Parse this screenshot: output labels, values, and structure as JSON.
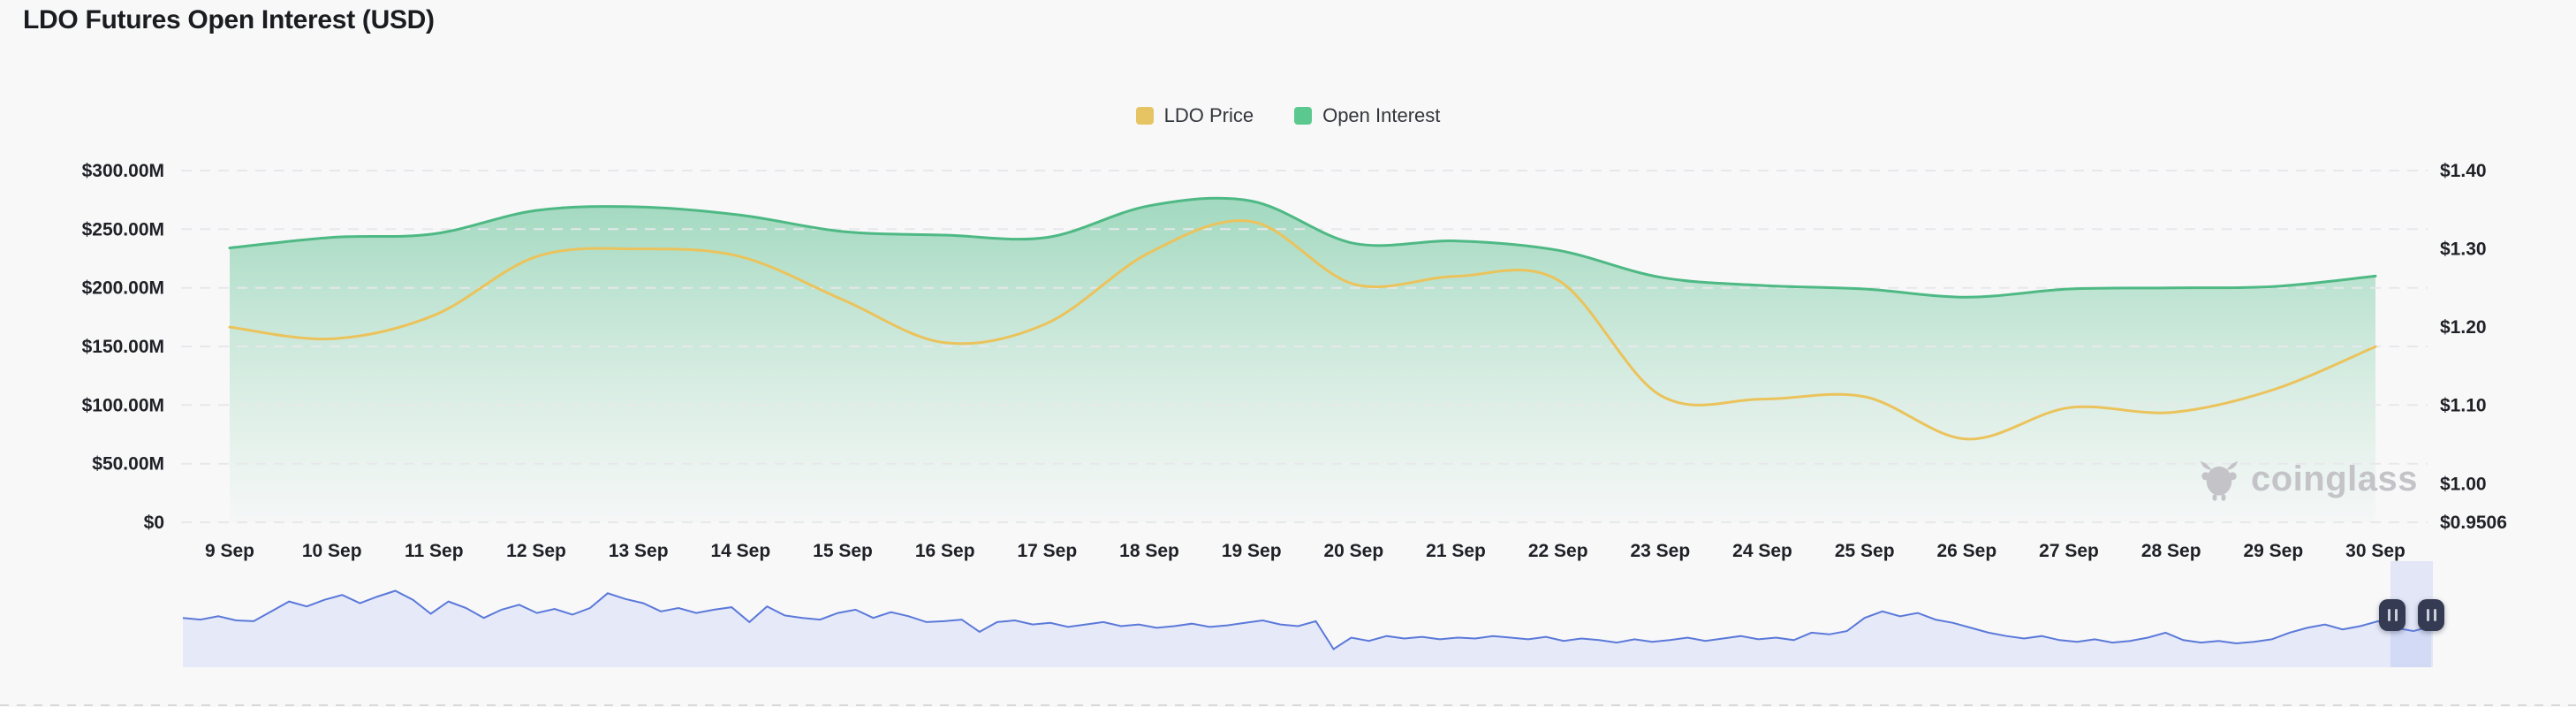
{
  "title": "LDO Futures Open Interest (USD)",
  "watermark": "coinglass",
  "legend": [
    {
      "label": "LDO Price",
      "color": "#e6c464"
    },
    {
      "label": "Open Interest",
      "color": "#5bc88f"
    }
  ],
  "colors": {
    "background": "#f8f8f9",
    "grid": "#e8e8ec",
    "price_line": "#ebc35c",
    "open_interest_line": "#4eb984",
    "open_interest_fill_top": "rgba(88,190,142,0.60)",
    "open_interest_fill_bottom": "rgba(140,212,172,0.03)",
    "navigator_line": "#5b79d9",
    "navigator_fill": "#e5e9f8",
    "navigator_selection": "rgba(125,150,233,0.18)",
    "handle_background": "#353b52",
    "axis_text": "#1f2126",
    "watermark_text": "#c4c4c8"
  },
  "chart_data": {
    "type": "area",
    "title": "LDO Futures Open Interest (USD)",
    "categories": [
      "9 Sep",
      "10 Sep",
      "11 Sep",
      "12 Sep",
      "13 Sep",
      "14 Sep",
      "15 Sep",
      "16 Sep",
      "17 Sep",
      "18 Sep",
      "19 Sep",
      "20 Sep",
      "21 Sep",
      "22 Sep",
      "23 Sep",
      "24 Sep",
      "25 Sep",
      "26 Sep",
      "27 Sep",
      "28 Sep",
      "29 Sep",
      "30 Sep"
    ],
    "series": [
      {
        "name": "Open Interest",
        "type": "area",
        "axis": "left",
        "unit": "million USD",
        "values": [
          234,
          243,
          246,
          266,
          269,
          262,
          248,
          245,
          243,
          270,
          274,
          238,
          240,
          232,
          209,
          202,
          199,
          192,
          199,
          200,
          201,
          210
        ]
      },
      {
        "name": "LDO Price",
        "type": "line",
        "axis": "right",
        "unit": "USD",
        "values": [
          1.2,
          1.185,
          1.215,
          1.29,
          1.3,
          1.29,
          1.235,
          1.18,
          1.205,
          1.295,
          1.335,
          1.255,
          1.265,
          1.26,
          1.113,
          1.108,
          1.111,
          1.057,
          1.097,
          1.091,
          1.12,
          1.175
        ]
      }
    ],
    "left_axis": {
      "tick_labels": [
        "$300.00M",
        "$250.00M",
        "$200.00M",
        "$150.00M",
        "$100.00M",
        "$50.00M",
        "$0"
      ],
      "tick_values": [
        300,
        250,
        200,
        150,
        100,
        50,
        0
      ],
      "min": 0,
      "max": 300
    },
    "right_axis": {
      "tick_labels": [
        "$1.40",
        "$1.30",
        "$1.20",
        "$1.10",
        "$1.00",
        "$0.9506"
      ],
      "tick_values": [
        1.4,
        1.3,
        1.2,
        1.1,
        1.0,
        0.9506
      ],
      "min": 0.9506,
      "max": 1.4
    },
    "grid": true,
    "legend_position": "top"
  },
  "navigator": {
    "values": [
      0.6,
      0.58,
      0.62,
      0.57,
      0.56,
      0.68,
      0.8,
      0.74,
      0.82,
      0.88,
      0.78,
      0.86,
      0.93,
      0.82,
      0.65,
      0.8,
      0.72,
      0.6,
      0.7,
      0.76,
      0.66,
      0.71,
      0.64,
      0.72,
      0.9,
      0.83,
      0.78,
      0.68,
      0.72,
      0.66,
      0.7,
      0.73,
      0.55,
      0.74,
      0.63,
      0.6,
      0.58,
      0.66,
      0.7,
      0.6,
      0.67,
      0.62,
      0.55,
      0.56,
      0.58,
      0.43,
      0.55,
      0.57,
      0.52,
      0.54,
      0.49,
      0.52,
      0.55,
      0.5,
      0.52,
      0.48,
      0.5,
      0.53,
      0.49,
      0.51,
      0.54,
      0.57,
      0.52,
      0.5,
      0.56,
      0.22,
      0.36,
      0.32,
      0.38,
      0.35,
      0.37,
      0.34,
      0.36,
      0.35,
      0.38,
      0.36,
      0.34,
      0.37,
      0.32,
      0.35,
      0.33,
      0.3,
      0.34,
      0.31,
      0.33,
      0.36,
      0.32,
      0.35,
      0.38,
      0.34,
      0.36,
      0.33,
      0.42,
      0.4,
      0.44,
      0.6,
      0.68,
      0.62,
      0.66,
      0.58,
      0.54,
      0.48,
      0.42,
      0.38,
      0.35,
      0.38,
      0.33,
      0.31,
      0.34,
      0.3,
      0.32,
      0.36,
      0.42,
      0.33,
      0.3,
      0.32,
      0.29,
      0.31,
      0.34,
      0.42,
      0.48,
      0.52,
      0.46,
      0.5,
      0.56,
      0.48,
      0.44,
      0.5
    ]
  }
}
